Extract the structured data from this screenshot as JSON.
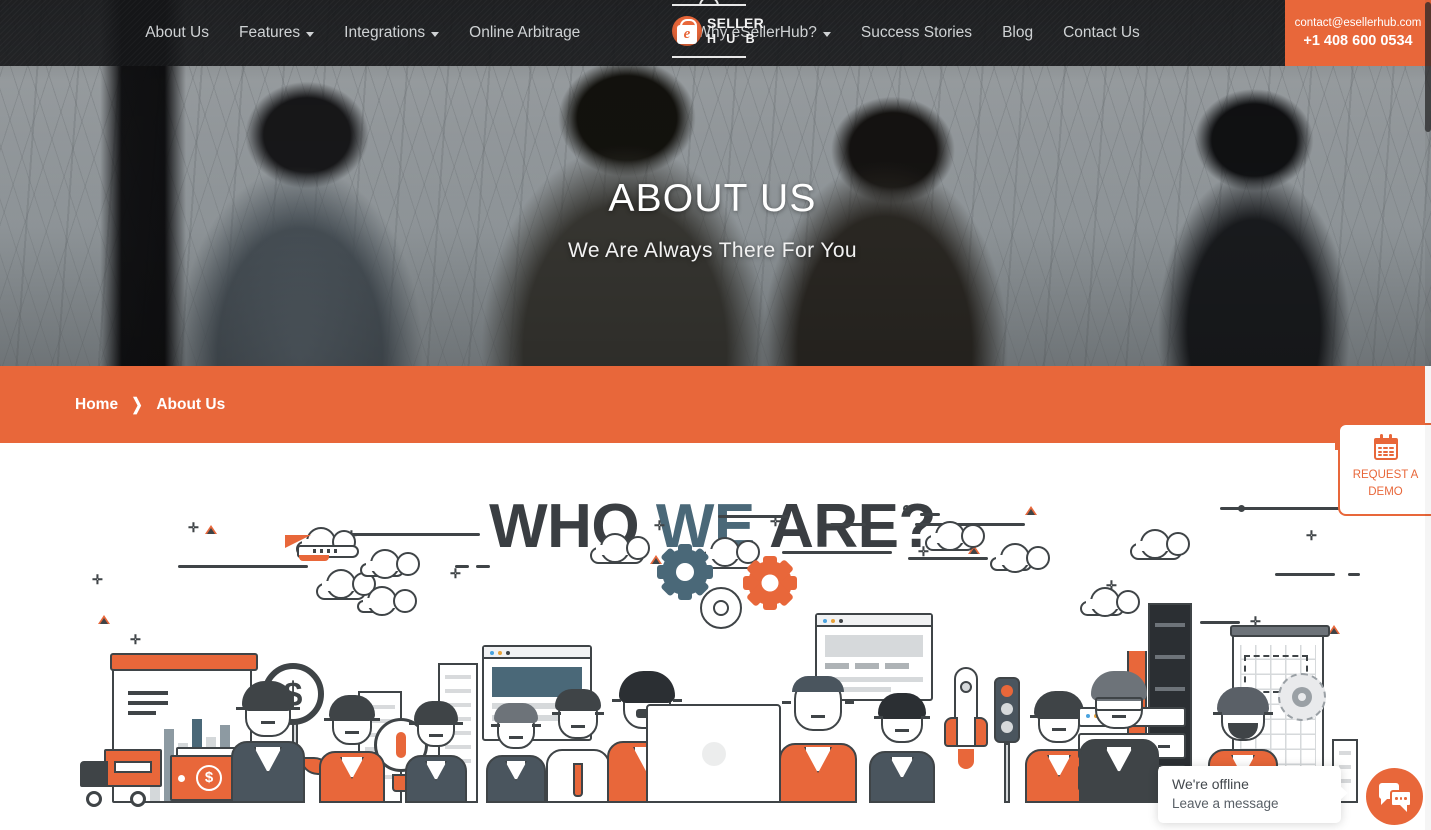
{
  "brand": {
    "logo_top_word": "SELLER",
    "logo_bottom_word": "H U B",
    "logo_icon": "esellerhub-lock-logo",
    "accent_color": "#e8673a",
    "dark_color": "#3a3e42",
    "slate_color": "#4a6878"
  },
  "header": {
    "nav": [
      {
        "label": "About Us",
        "has_dropdown": false
      },
      {
        "label": "Features",
        "has_dropdown": true
      },
      {
        "label": "Integrations",
        "has_dropdown": true
      },
      {
        "label": "Online Arbitrage",
        "has_dropdown": false
      },
      {
        "label": "Why eSellerHub?",
        "has_dropdown": true
      },
      {
        "label": "Success Stories",
        "has_dropdown": false
      },
      {
        "label": "Blog",
        "has_dropdown": false
      },
      {
        "label": "Contact Us",
        "has_dropdown": false
      }
    ],
    "contact": {
      "email": "contact@esellerhub.com",
      "phone": "+1 408 600 0534"
    }
  },
  "hero": {
    "title": "ABOUT US",
    "subtitle": "We Are Always There For You"
  },
  "breadcrumb": {
    "items": [
      {
        "label": "Home",
        "current": false
      },
      {
        "label": "About Us",
        "current": true
      }
    ],
    "separator": "❯"
  },
  "main": {
    "section_title": {
      "part1": "WHO ",
      "accent": "WE",
      "part2": " ARE?"
    },
    "illustration": "business-team-flat-illustration"
  },
  "demo_widget": {
    "line1": "REQUEST A",
    "line2": "DEMO",
    "icon": "calendar-icon"
  },
  "chat": {
    "status": "We're offline",
    "prompt": "Leave a message",
    "icon": "chat-bubbles-icon"
  }
}
